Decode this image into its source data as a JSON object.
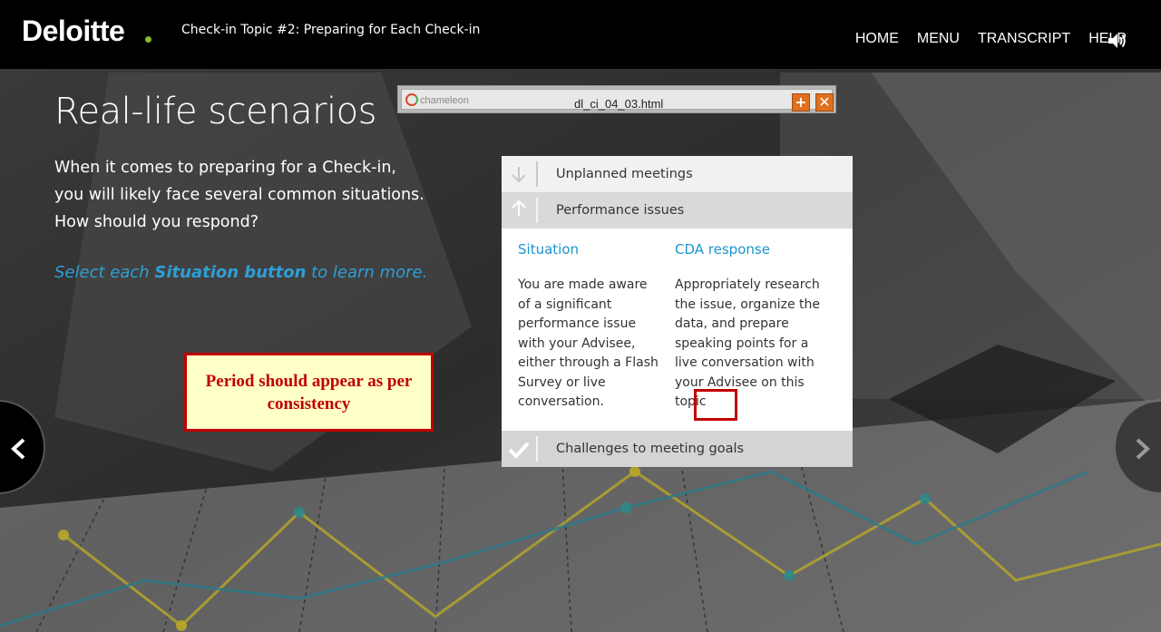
{
  "header": {
    "logo": "Deloitte",
    "course_title": "Check-in Topic #2: Preparing for Each Check-in",
    "nav": [
      "HOME",
      "MENU",
      "TRANSCRIPT",
      "HELP"
    ]
  },
  "chameleon": {
    "logo": "chameleon",
    "filename": "dl_ci_04_03.html",
    "plus_label": "+",
    "close_label": "✕"
  },
  "main": {
    "heading": "Real-life scenarios",
    "intro": "When it comes to preparing for a Check-in, you will likely face several common situations. How should you respond?",
    "instruction_pre": "Select each ",
    "instruction_bold": "Situation button",
    "instruction_post": " to learn more."
  },
  "callout": {
    "text": "Period should appear as per consistency"
  },
  "accordion": {
    "items": [
      {
        "label": "Unplanned meetings",
        "icon": "arrow-down-icon"
      },
      {
        "label": "Performance issues",
        "icon": "arrow-up-icon"
      },
      {
        "label": "Challenges to meeting goals",
        "icon": "checkmark-icon"
      }
    ],
    "situation_header": "Situation",
    "response_header": "CDA response",
    "situation_text": "You are made aware of a significant performance issue with your Advisee, either through a Flash Survey or live conversation.",
    "response_text": "Appropriately research the issue, organize the data, and prepare speaking points for a live conversation with your Advisee on this topic"
  },
  "colors": {
    "brand_green": "#86bc25",
    "link_blue": "#2f9fd6",
    "annotation_red": "#c00000"
  }
}
